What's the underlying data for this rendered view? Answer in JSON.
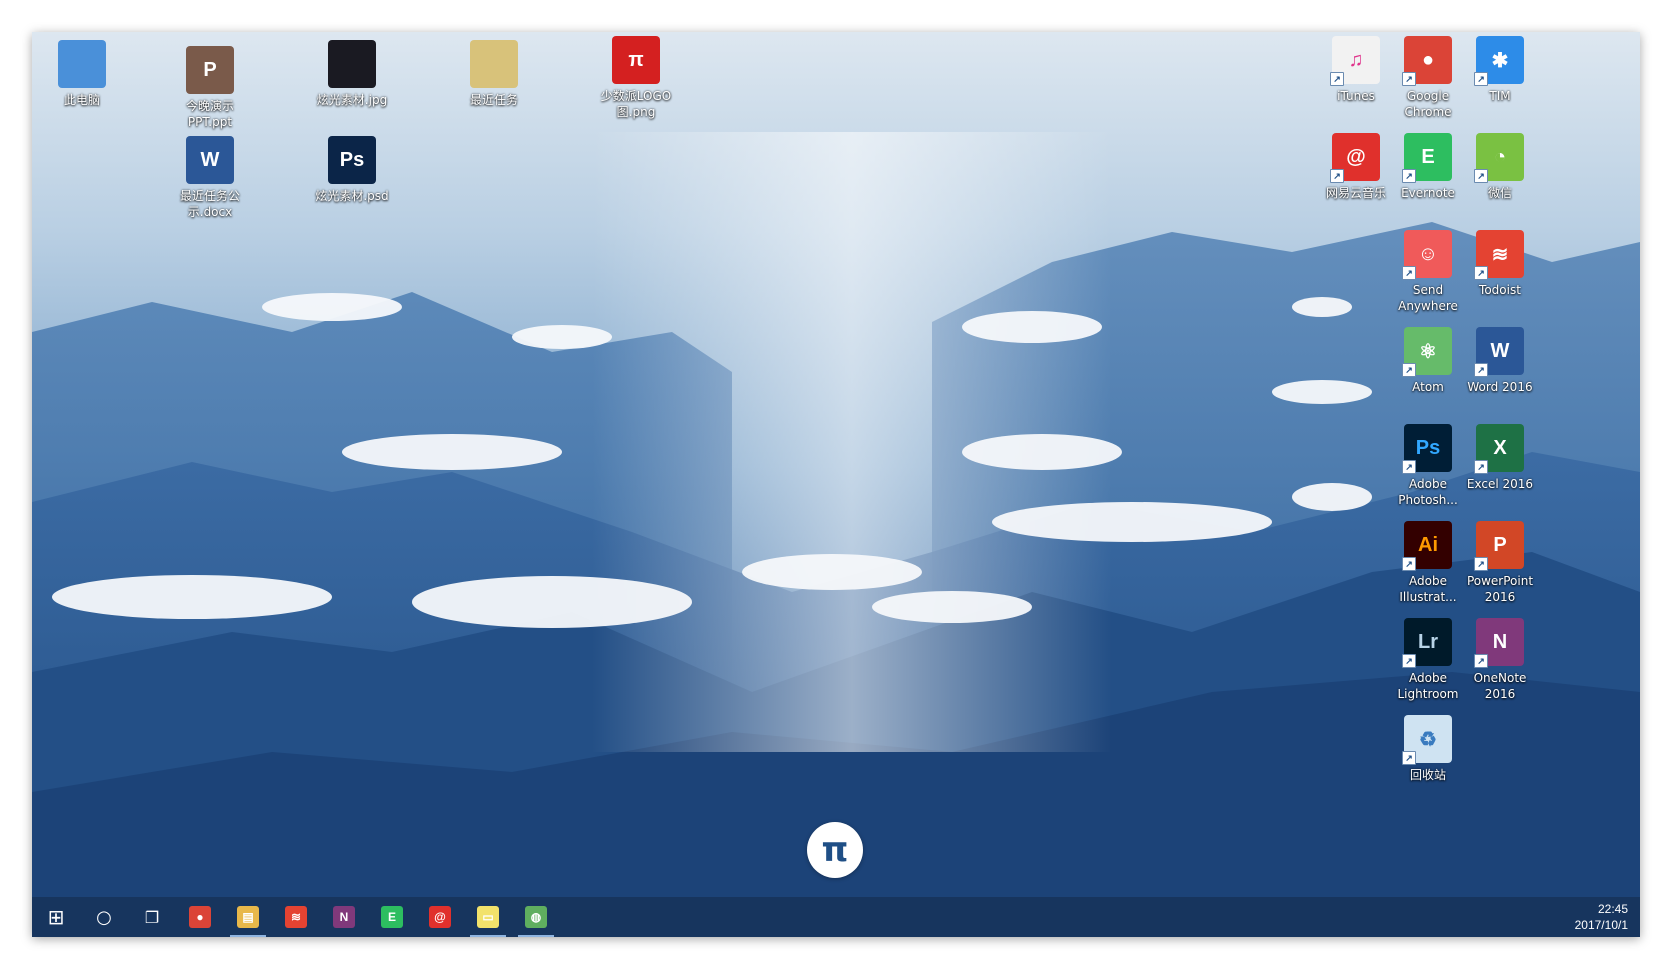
{
  "desktop_icons_left": [
    {
      "name": "this-pc-icon",
      "label": "此电脑",
      "color": "#4a90d9",
      "glyph": ""
    },
    {
      "name": "ppt-file-icon",
      "label": "今晚演示PPT.ppt",
      "color": "#7a5a4a",
      "glyph": "P"
    },
    {
      "name": "jpg-file-icon",
      "label": "炫光素材.jpg",
      "color": "#1a1a22",
      "glyph": ""
    },
    {
      "name": "folder-icon",
      "label": "最近任务",
      "color": "#d8c27a",
      "glyph": ""
    },
    {
      "name": "png-file-icon",
      "label": "少数派LOGO图.png",
      "color": "#d42020",
      "glyph": "π"
    },
    {
      "name": "docx-file-icon",
      "label": "最近任务公示.docx",
      "color": "#2b5797",
      "glyph": "W"
    },
    {
      "name": "psd-file-icon",
      "label": "炫光素材.psd",
      "color": "#0b2548",
      "glyph": "Ps"
    }
  ],
  "desktop_icons_right": [
    {
      "name": "itunes-icon",
      "label": "iTunes",
      "color": "#f2f2f2",
      "glyph": "♫",
      "glyph_color": "#e0338b"
    },
    {
      "name": "chrome-icon",
      "label": "Google Chrome",
      "color": "#db4437",
      "glyph": "●",
      "glyph_color": "#ffffff"
    },
    {
      "name": "tim-icon",
      "label": "TIM",
      "color": "#2d8ce8",
      "glyph": "✱",
      "glyph_color": "#ffffff"
    },
    {
      "name": "netease-music-icon",
      "label": "网易云音乐",
      "color": "#e0302c",
      "glyph": "@",
      "glyph_color": "#ffffff"
    },
    {
      "name": "evernote-icon",
      "label": "Evernote",
      "color": "#2dbe60",
      "glyph": "E",
      "glyph_color": "#ffffff"
    },
    {
      "name": "wechat-icon",
      "label": "微信",
      "color": "#7ac142",
      "glyph": "◔",
      "glyph_color": "#ffffff"
    },
    {
      "name": "send-anywhere-icon",
      "label": "Send Anywhere",
      "color": "#f05a5a",
      "glyph": "☺",
      "glyph_color": "#ffffff"
    },
    {
      "name": "todoist-icon",
      "label": "Todoist",
      "color": "#e44332",
      "glyph": "≋",
      "glyph_color": "#ffffff"
    },
    {
      "name": "atom-icon",
      "label": "Atom",
      "color": "#66bb6a",
      "glyph": "⚛",
      "glyph_color": "#ffffff"
    },
    {
      "name": "word-icon",
      "label": "Word 2016",
      "color": "#2b5797",
      "glyph": "W",
      "glyph_color": "#ffffff"
    },
    {
      "name": "photoshop-icon",
      "label": "Adobe Photosh...",
      "color": "#001e36",
      "glyph": "Ps",
      "glyph_color": "#31a8ff"
    },
    {
      "name": "excel-icon",
      "label": "Excel 2016",
      "color": "#1e7145",
      "glyph": "X",
      "glyph_color": "#ffffff"
    },
    {
      "name": "illustrator-icon",
      "label": "Adobe Illustrat...",
      "color": "#330000",
      "glyph": "Ai",
      "glyph_color": "#ff9a00"
    },
    {
      "name": "powerpoint-icon",
      "label": "PowerPoint 2016",
      "color": "#d24726",
      "glyph": "P",
      "glyph_color": "#ffffff"
    },
    {
      "name": "lightroom-icon",
      "label": "Adobe Lightroom",
      "color": "#001a2a",
      "glyph": "Lr",
      "glyph_color": "#b8d4e8"
    },
    {
      "name": "onenote-icon",
      "label": "OneNote 2016",
      "color": "#80397b",
      "glyph": "N",
      "glyph_color": "#ffffff"
    },
    {
      "name": "recycle-bin-icon",
      "label": "回收站",
      "color": "#cfe3f2",
      "glyph": "♻",
      "glyph_color": "#3a7bbf"
    }
  ],
  "floating_button": {
    "glyph": "π"
  },
  "taskbar": {
    "start_glyph": "⊞",
    "search_glyph": "○",
    "taskview_glyph": "❐",
    "apps": [
      {
        "name": "taskbar-chrome-icon",
        "glyph": "●",
        "color": "#db4437",
        "active": false
      },
      {
        "name": "taskbar-file-explorer-icon",
        "glyph": "▤",
        "color": "#e8b84a",
        "active": true
      },
      {
        "name": "taskbar-todoist-icon",
        "glyph": "≋",
        "color": "#e44332",
        "active": false
      },
      {
        "name": "taskbar-onenote-icon",
        "glyph": "N",
        "color": "#80397b",
        "active": false
      },
      {
        "name": "taskbar-evernote-icon",
        "glyph": "E",
        "color": "#2dbe60",
        "active": false
      },
      {
        "name": "taskbar-netease-music-icon",
        "glyph": "@",
        "color": "#e0302c",
        "active": false
      },
      {
        "name": "taskbar-sticky-notes-icon",
        "glyph": "▭",
        "color": "#f2e26b",
        "active": true
      },
      {
        "name": "taskbar-globe-icon",
        "glyph": "◍",
        "color": "#5fae5f",
        "active": true
      }
    ],
    "time": "22:45",
    "date": "2017/10/1"
  }
}
